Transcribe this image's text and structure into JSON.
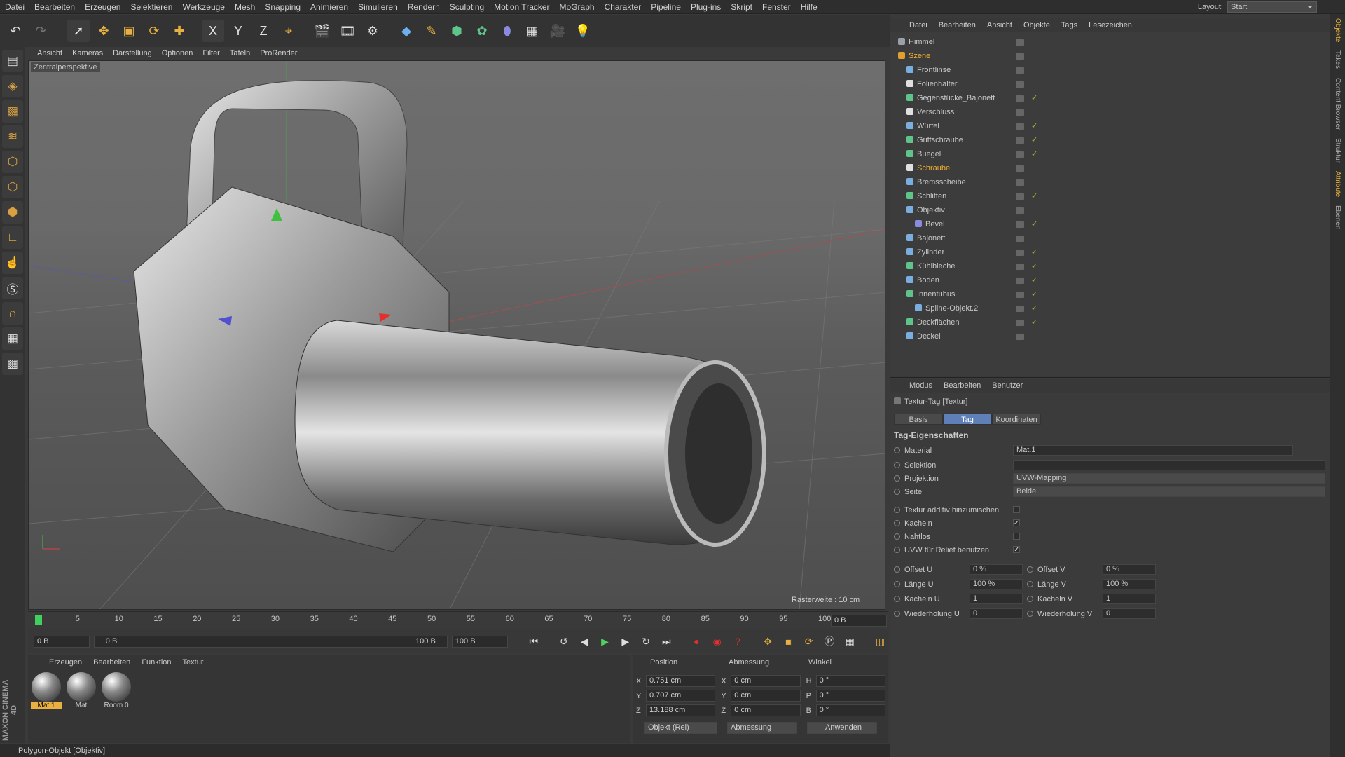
{
  "menubar": {
    "items": [
      "Datei",
      "Bearbeiten",
      "Erzeugen",
      "Selektieren",
      "Werkzeuge",
      "Mesh",
      "Snapping",
      "Animieren",
      "Simulieren",
      "Rendern",
      "Sculpting",
      "Motion Tracker",
      "MoGraph",
      "Charakter",
      "Pipeline",
      "Plug-ins",
      "Skript",
      "Fenster",
      "Hilfe"
    ],
    "layout_label": "Layout:",
    "layout_value": "Start"
  },
  "toolbar": {
    "icons": [
      "undo-icon",
      "redo-icon",
      "select-icon",
      "move-icon",
      "scale-icon",
      "rotate-icon",
      "add-icon",
      "x-axis-icon",
      "y-axis-icon",
      "z-axis-icon",
      "coordinate-icon",
      "render-view-icon",
      "render-icon",
      "render-settings-icon",
      "cube-icon",
      "pen-icon",
      "subdivision-icon",
      "cloner-icon",
      "deformer-icon",
      "floor-icon",
      "camera-icon",
      "light-icon"
    ],
    "axis_x": "X",
    "axis_y": "Y",
    "axis_z": "Z"
  },
  "viewport": {
    "menu": [
      "Ansicht",
      "Kameras",
      "Darstellung",
      "Optionen",
      "Filter",
      "Tafeln",
      "ProRender"
    ],
    "label": "Zentralperspektive",
    "raster": "Rasterweite : 10 cm"
  },
  "timeline": {
    "ticks": [
      "0",
      "5",
      "10",
      "15",
      "20",
      "25",
      "30",
      "35",
      "40",
      "45",
      "50",
      "55",
      "60",
      "65",
      "70",
      "75",
      "80",
      "85",
      "90",
      "95",
      "100"
    ],
    "end_frame": "0 B",
    "current_start": "0 B",
    "range_start": "0 B",
    "range_end": "100 B",
    "max": "100 B",
    "playhead": 0
  },
  "materials": {
    "menu": [
      "Erzeugen",
      "Bearbeiten",
      "Funktion",
      "Textur"
    ],
    "items": [
      "Mat.1",
      "Mat",
      "Room 0"
    ]
  },
  "coords": {
    "headers": [
      "Position",
      "Abmessung",
      "Winkel"
    ],
    "rows": [
      {
        "axis": "X",
        "pos": "0.751 cm",
        "dimaxis": "X",
        "dim": "0 cm",
        "angaxis": "H",
        "ang": "0 °"
      },
      {
        "axis": "Y",
        "pos": "0.707 cm",
        "dimaxis": "Y",
        "dim": "0 cm",
        "angaxis": "P",
        "ang": "0 °"
      },
      {
        "axis": "Z",
        "pos": "13.188 cm",
        "dimaxis": "Z",
        "dim": "0 cm",
        "angaxis": "B",
        "ang": "0 °"
      }
    ],
    "mode": "Objekt (Rel)",
    "size_mode": "Abmessung",
    "apply": "Anwenden"
  },
  "status": "Polygon-Objekt [Objektiv]",
  "objmgr": {
    "menu": [
      "Datei",
      "Bearbeiten",
      "Ansicht",
      "Objekte",
      "Tags",
      "Lesezeichen"
    ],
    "rows": [
      {
        "name": "Himmel",
        "indent": 0,
        "color": "#9aa0a8",
        "check": false,
        "highlight": false
      },
      {
        "name": "Szene",
        "indent": 0,
        "color": "#e0a030",
        "check": false,
        "highlight": true
      },
      {
        "name": "Frontlinse",
        "indent": 1,
        "color": "#7aaee0",
        "check": false,
        "highlight": false
      },
      {
        "name": "Folienhalter",
        "indent": 1,
        "color": "#e0e0e0",
        "check": false,
        "highlight": false
      },
      {
        "name": "Gegenstücke_Bajonett",
        "indent": 1,
        "color": "#5ec48a",
        "check": true,
        "highlight": false
      },
      {
        "name": "Verschluss",
        "indent": 1,
        "color": "#e0e0e0",
        "check": false,
        "highlight": false
      },
      {
        "name": "Würfel",
        "indent": 1,
        "color": "#7aaee0",
        "check": true,
        "highlight": false
      },
      {
        "name": "Griffschraube",
        "indent": 1,
        "color": "#5ec48a",
        "check": true,
        "highlight": false
      },
      {
        "name": "Buegel",
        "indent": 1,
        "color": "#5ec48a",
        "check": true,
        "highlight": false
      },
      {
        "name": "Schraube",
        "indent": 1,
        "color": "#e0e0e0",
        "check": false,
        "highlight": true
      },
      {
        "name": "Bremsscheibe",
        "indent": 1,
        "color": "#7aaee0",
        "check": false,
        "highlight": false
      },
      {
        "name": "Schlitten",
        "indent": 1,
        "color": "#5ec48a",
        "check": true,
        "highlight": false
      },
      {
        "name": "Objektiv",
        "indent": 1,
        "color": "#7aaee0",
        "check": false,
        "highlight": false
      },
      {
        "name": "Bevel",
        "indent": 2,
        "color": "#8a8ae0",
        "check": true,
        "highlight": false
      },
      {
        "name": "Bajonett",
        "indent": 1,
        "color": "#7aaee0",
        "check": false,
        "highlight": false
      },
      {
        "name": "Zylinder",
        "indent": 1,
        "color": "#7aaee0",
        "check": true,
        "highlight": false
      },
      {
        "name": "Kühlbleche",
        "indent": 1,
        "color": "#5ec48a",
        "check": true,
        "highlight": false
      },
      {
        "name": "Boden",
        "indent": 1,
        "color": "#7aaee0",
        "check": true,
        "highlight": false
      },
      {
        "name": "Innentubus",
        "indent": 1,
        "color": "#5ec48a",
        "check": true,
        "highlight": false
      },
      {
        "name": "Spline-Objekt.2",
        "indent": 2,
        "color": "#7aaee0",
        "check": true,
        "highlight": false
      },
      {
        "name": "Deckflächen",
        "indent": 1,
        "color": "#5ec48a",
        "check": true,
        "highlight": false
      },
      {
        "name": "Deckel",
        "indent": 1,
        "color": "#7aaee0",
        "check": false,
        "highlight": false
      }
    ]
  },
  "attr": {
    "menu": [
      "Modus",
      "Bearbeiten",
      "Benutzer"
    ],
    "title": "Textur-Tag [Textur]",
    "tabs": [
      "Basis",
      "Tag",
      "Koordinaten"
    ],
    "section": "Tag-Eigenschaften",
    "material_label": "Material",
    "material_value": "Mat.1",
    "selektion_label": "Selektion",
    "projektion_label": "Projektion",
    "projektion_value": "UVW-Mapping",
    "seite_label": "Seite",
    "seite_value": "Beide",
    "additiv_label": "Textur additiv hinzumischen",
    "kacheln_label": "Kacheln",
    "nahtlos_label": "Nahtlos",
    "uvw_label": "UVW für Relief benutzen",
    "offset_u_label": "Offset U",
    "offset_u": "0 %",
    "offset_v_label": "Offset V",
    "offset_v": "0 %",
    "laenge_u_label": "Länge U",
    "laenge_u": "100 %",
    "laenge_v_label": "Länge V",
    "laenge_v": "100 %",
    "kacheln_u_label": "Kacheln U",
    "kacheln_u": "1",
    "kacheln_v_label": "Kacheln V",
    "kacheln_v": "1",
    "wdh_u_label": "Wiederholung U",
    "wdh_u": "0",
    "wdh_v_label": "Wiederholung V",
    "wdh_v": "0"
  },
  "rightside": [
    "Objekte",
    "Takes",
    "Content Browser",
    "Struktur",
    "Attribute",
    "Ebenen"
  ],
  "brand": "MAXON CINEMA 4D"
}
